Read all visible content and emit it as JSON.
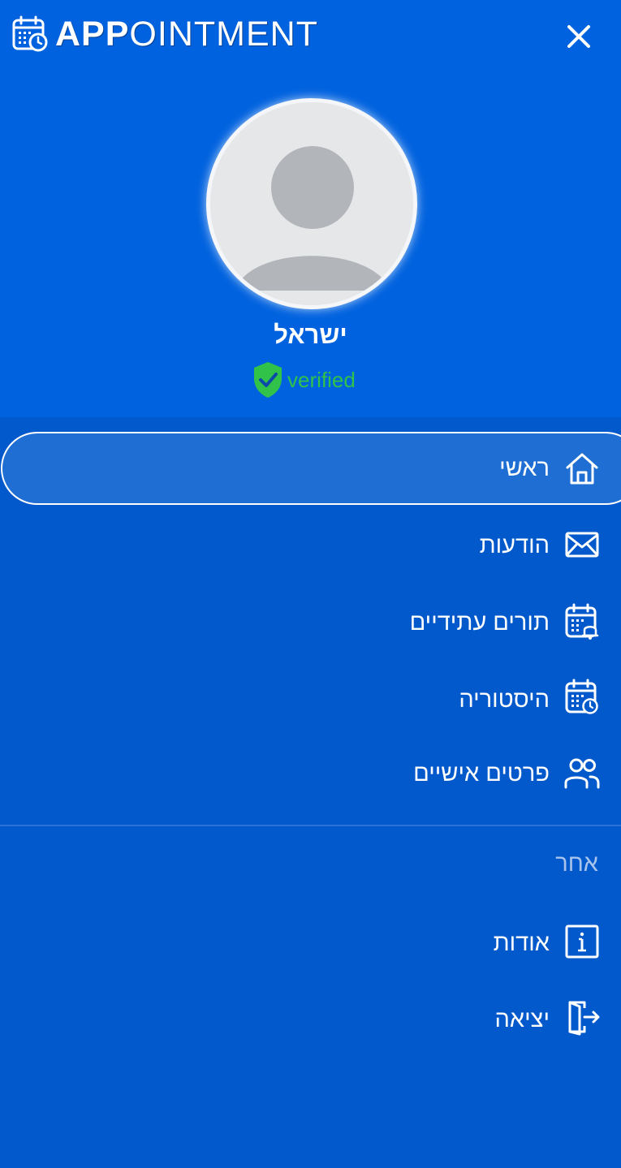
{
  "app": {
    "title_bold": "APP",
    "title_light": "OINTMENT",
    "logo_icon": "calendar-clock-icon",
    "close_icon": "close-icon"
  },
  "user": {
    "name": "ישראל",
    "verified_label": "verified",
    "avatar_icon": "avatar-placeholder-icon",
    "verified_icon": "shield-check-icon"
  },
  "menu": {
    "main_items": [
      {
        "label": "ראשי",
        "icon": "home-icon",
        "active": true
      },
      {
        "label": "הודעות",
        "icon": "envelope-icon",
        "active": false
      },
      {
        "label": "תורים עתידיים",
        "icon": "calendar-bell-icon",
        "active": false
      },
      {
        "label": "היסטוריה",
        "icon": "calendar-clock-icon",
        "active": false
      },
      {
        "label": "פרטים אישיים",
        "icon": "users-icon",
        "active": false
      }
    ],
    "other_section_label": "אחר",
    "other_items": [
      {
        "label": "אודות",
        "icon": "info-icon"
      },
      {
        "label": "יציאה",
        "icon": "logout-icon"
      }
    ]
  },
  "colors": {
    "header_bg": "#0062df",
    "menu_bg": "#0259cc",
    "active_item_bg": "#1f6ed3",
    "verified_green": "#31c24a",
    "section_label": "#a8c4ec"
  }
}
